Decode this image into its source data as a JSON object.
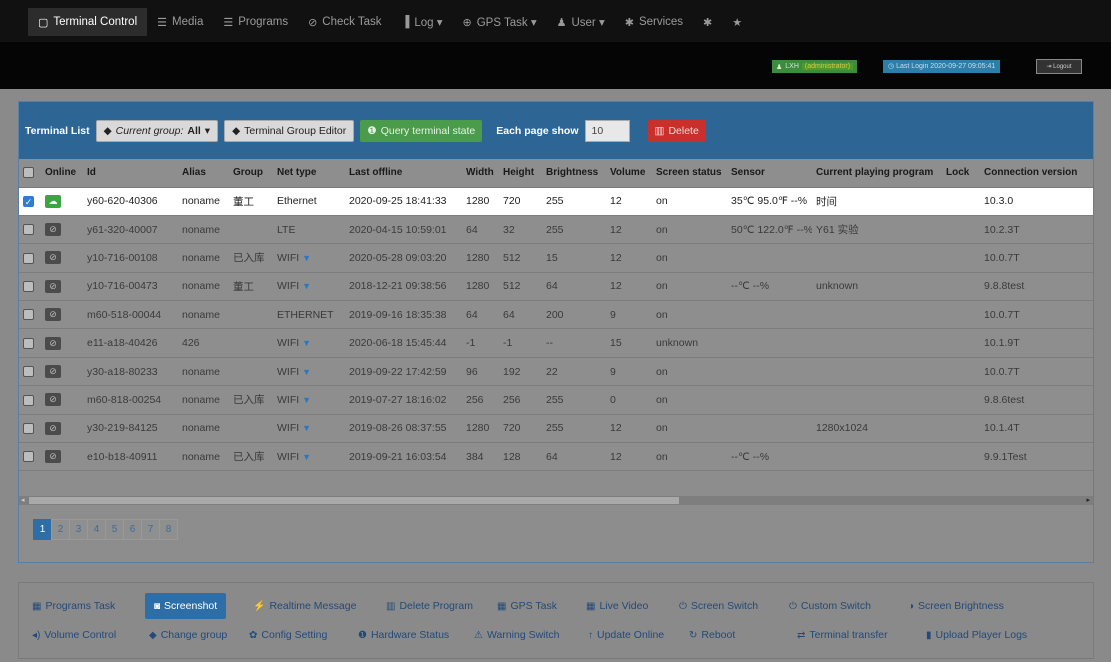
{
  "nav": {
    "items": [
      {
        "icon": "terminal-icon",
        "glyph": "▢",
        "label": "Terminal Control",
        "active": true
      },
      {
        "icon": "media-icon",
        "glyph": "☰",
        "label": "Media"
      },
      {
        "icon": "programs-icon",
        "glyph": "☰",
        "label": "Programs"
      },
      {
        "icon": "check-icon",
        "glyph": "⊘",
        "label": "Check Task"
      },
      {
        "icon": "log-icon",
        "glyph": "▐",
        "label": "Log ▾"
      },
      {
        "icon": "globe-icon",
        "glyph": "⊕",
        "label": "GPS Task ▾"
      },
      {
        "icon": "user-icon",
        "glyph": "♟",
        "label": "User ▾"
      },
      {
        "icon": "services-icon",
        "glyph": "✱",
        "label": "Services"
      },
      {
        "icon": "asterisk-icon",
        "glyph": "✱",
        "label": ""
      },
      {
        "icon": "star-icon",
        "glyph": "★",
        "label": ""
      }
    ]
  },
  "header": {
    "user": "LXH",
    "role": "(administrator)",
    "last_login": "Last Login 2020-09-27 09:05:41",
    "logout": "Logout"
  },
  "toolbar": {
    "terminal_list": "Terminal List",
    "current_group_prefix": "Current group:",
    "current_group_value": "All",
    "group_editor": "Terminal Group Editor",
    "query_state": "Query terminal state",
    "each_page_show": "Each page show",
    "page_size": "10",
    "delete": "Delete"
  },
  "table": {
    "columns": [
      "Online",
      "Id",
      "Alias",
      "Group",
      "Net type",
      "Last offline",
      "Width",
      "Height",
      "Brightness",
      "Volume",
      "Screen status",
      "Sensor",
      "Current playing program",
      "Lock",
      "Connection version"
    ],
    "rows": [
      {
        "checked": true,
        "online": true,
        "id": "y60-620-40306",
        "alias": "noname",
        "group": "董工",
        "net": "Ethernet",
        "wifi": false,
        "last": "2020-09-25 18:41:33",
        "w": "1280",
        "h": "720",
        "bright": "255",
        "vol": "12",
        "screen": "on",
        "sensor": "35℃ 95.0℉ --%",
        "program": "时间",
        "lock": "",
        "ver": "10.3.0"
      },
      {
        "checked": false,
        "online": false,
        "id": "y61-320-40007",
        "alias": "noname",
        "group": "",
        "net": "LTE",
        "wifi": false,
        "last": "2020-04-15 10:59:01",
        "w": "64",
        "h": "32",
        "bright": "255",
        "vol": "12",
        "screen": "on",
        "sensor": "50℃ 122.0℉ --%",
        "program": "Y61 实验",
        "lock": "",
        "ver": "10.2.3T"
      },
      {
        "checked": false,
        "online": false,
        "id": "y10-716-00108",
        "alias": "noname",
        "group": "已入库",
        "net": "WIFI",
        "wifi": true,
        "last": "2020-05-28 09:03:20",
        "w": "1280",
        "h": "512",
        "bright": "15",
        "vol": "12",
        "screen": "on",
        "sensor": "",
        "program": "",
        "lock": "",
        "ver": "10.0.7T"
      },
      {
        "checked": false,
        "online": false,
        "id": "y10-716-00473",
        "alias": "noname",
        "group": "董工",
        "net": "WIFI",
        "wifi": true,
        "last": "2018-12-21 09:38:56",
        "w": "1280",
        "h": "512",
        "bright": "64",
        "vol": "12",
        "screen": "on",
        "sensor": "--℃ --%",
        "program": "unknown",
        "lock": "",
        "ver": "9.8.8test"
      },
      {
        "checked": false,
        "online": false,
        "id": "m60-518-00044",
        "alias": "noname",
        "group": "",
        "net": "ETHERNET",
        "wifi": false,
        "last": "2019-09-16 18:35:38",
        "w": "64",
        "h": "64",
        "bright": "200",
        "vol": "9",
        "screen": "on",
        "sensor": "",
        "program": "",
        "lock": "",
        "ver": "10.0.7T"
      },
      {
        "checked": false,
        "online": false,
        "id": "e11-a18-40426",
        "alias": "426",
        "group": "",
        "net": "WIFI",
        "wifi": true,
        "last": "2020-06-18 15:45:44",
        "w": "-1",
        "h": "-1",
        "bright": "--",
        "vol": "15",
        "screen": "unknown",
        "sensor": "",
        "program": "",
        "lock": "",
        "ver": "10.1.9T"
      },
      {
        "checked": false,
        "online": false,
        "id": "y30-a18-80233",
        "alias": "noname",
        "group": "",
        "net": "WIFI",
        "wifi": true,
        "last": "2019-09-22 17:42:59",
        "w": "96",
        "h": "192",
        "bright": "22",
        "vol": "9",
        "screen": "on",
        "sensor": "",
        "program": "",
        "lock": "",
        "ver": "10.0.7T"
      },
      {
        "checked": false,
        "online": false,
        "id": "m60-818-00254",
        "alias": "noname",
        "group": "已入库",
        "net": "WIFI",
        "wifi": true,
        "last": "2019-07-27 18:16:02",
        "w": "256",
        "h": "256",
        "bright": "255",
        "vol": "0",
        "screen": "on",
        "sensor": "",
        "program": "",
        "lock": "",
        "ver": "9.8.6test"
      },
      {
        "checked": false,
        "online": false,
        "id": "y30-219-84125",
        "alias": "noname",
        "group": "",
        "net": "WIFI",
        "wifi": true,
        "last": "2019-08-26 08:37:55",
        "w": "1280",
        "h": "720",
        "bright": "255",
        "vol": "12",
        "screen": "on",
        "sensor": "",
        "program": "1280x1024",
        "lock": "",
        "ver": "10.1.4T"
      },
      {
        "checked": false,
        "online": false,
        "id": "e10-b18-40911",
        "alias": "noname",
        "group": "已入库",
        "net": "WIFI",
        "wifi": true,
        "last": "2019-09-21 16:03:54",
        "w": "384",
        "h": "128",
        "bright": "64",
        "vol": "12",
        "screen": "on",
        "sensor": "--℃ --%",
        "program": "",
        "lock": "",
        "ver": "9.9.1Test"
      }
    ]
  },
  "pagination": {
    "pages": [
      "1",
      "2",
      "3",
      "4",
      "5",
      "6",
      "7",
      "8"
    ],
    "current": "1"
  },
  "actions": {
    "row1": [
      {
        "icon": "programs-task-icon",
        "glyph": "▦",
        "label": "Programs Task"
      },
      {
        "icon": "camera-icon",
        "glyph": "◙",
        "label": "Screenshot",
        "primary": true
      },
      {
        "icon": "bolt-icon",
        "glyph": "⚡",
        "label": "Realtime Message"
      },
      {
        "icon": "trash-icon",
        "glyph": "▥",
        "label": "Delete Program"
      },
      {
        "icon": "gps-task-icon",
        "glyph": "▦",
        "label": "GPS Task"
      },
      {
        "icon": "live-video-icon",
        "glyph": "▦",
        "label": "Live Video"
      },
      {
        "icon": "power-icon",
        "glyph": "⏻",
        "label": "Screen Switch"
      },
      {
        "icon": "power-icon",
        "glyph": "⏻",
        "label": "Custom Switch"
      },
      {
        "icon": "brightness-icon",
        "glyph": "◑",
        "label": "Screen Brightness"
      }
    ],
    "row2": [
      {
        "icon": "volume-icon",
        "glyph": "◂)",
        "label": "Volume Control"
      },
      {
        "icon": "tag-icon",
        "glyph": "◆",
        "label": "Change group"
      },
      {
        "icon": "gear-icon",
        "glyph": "✿",
        "label": "Config Setting"
      },
      {
        "icon": "info-icon",
        "glyph": "❶",
        "label": "Hardware Status"
      },
      {
        "icon": "warning-icon",
        "glyph": "⚠",
        "label": "Warning Switch"
      },
      {
        "icon": "arrow-up-icon",
        "glyph": "↑",
        "label": "Update Online"
      },
      {
        "icon": "refresh-icon",
        "glyph": "↻",
        "label": "Reboot"
      },
      {
        "icon": "transfer-icon",
        "glyph": "⇄",
        "label": "Terminal transfer"
      },
      {
        "icon": "file-icon",
        "glyph": "▮",
        "label": "Upload Player Logs"
      }
    ]
  }
}
